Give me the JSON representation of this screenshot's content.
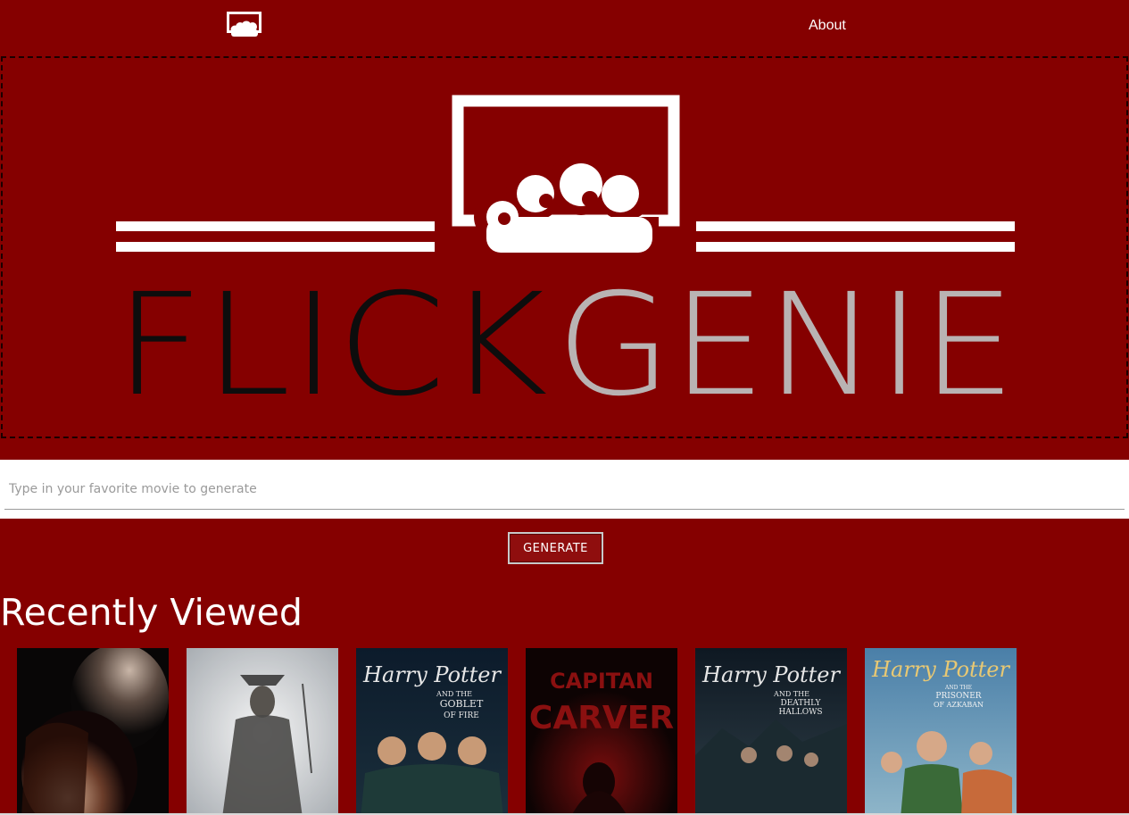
{
  "nav": {
    "logo_icon": "audience-screen-icon",
    "about_label": "About"
  },
  "hero": {
    "word_flick": "FLICK",
    "word_genie": "GENIE",
    "colors": {
      "flick": "#0d0d0d",
      "genie": "#b9b3b3",
      "emblem": "#ffffff"
    }
  },
  "search": {
    "placeholder": "Type in your favorite movie to generate",
    "value": ""
  },
  "generate": {
    "label": "GENERATE"
  },
  "recent": {
    "title": "Recently Viewed",
    "posters": [
      {
        "icon": "twilight-poster",
        "title_lines": []
      },
      {
        "icon": "pirates-poster",
        "title_lines": []
      },
      {
        "icon": "harry-potter-goblet-poster",
        "title_lines": [
          "Harry Potter",
          "AND THE",
          "GOBLET",
          "OF FIRE"
        ]
      },
      {
        "icon": "capitan-carver-poster",
        "title_lines": [
          "CAPITAN",
          "CARVER"
        ]
      },
      {
        "icon": "harry-potter-hallows-poster",
        "title_lines": [
          "Harry Potter",
          "AND THE",
          "DEATHLY",
          "HALLOWS"
        ]
      },
      {
        "icon": "harry-potter-azkaban-poster",
        "title_lines": [
          "Harry Potter",
          "AND THE",
          "PRISONER",
          "OF AZKABAN"
        ]
      }
    ]
  },
  "theme": {
    "background": "#850000",
    "button": "#8f0e0e",
    "text": "#ffffff"
  }
}
